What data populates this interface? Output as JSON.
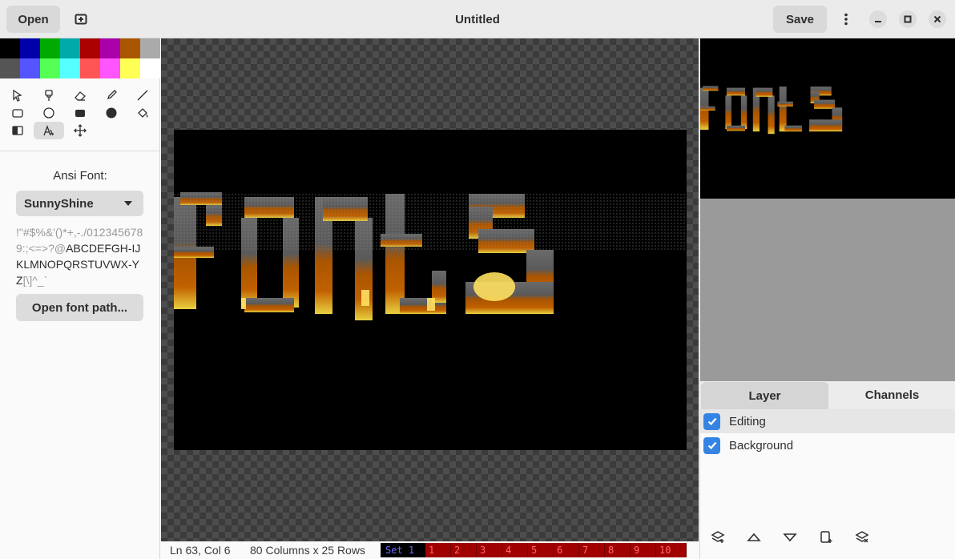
{
  "header": {
    "title": "Untitled",
    "open_label": "Open",
    "save_label": "Save",
    "icons": [
      "new-document-icon",
      "menu-icon",
      "minimize-icon",
      "maximize-icon",
      "close-icon"
    ]
  },
  "colors": {
    "foreground": "#aaaaaa",
    "background": "#000000",
    "palette_row1": [
      "#000000",
      "#0000aa",
      "#00aa00",
      "#00aaaa",
      "#aa0000",
      "#aa00aa",
      "#aa5500",
      "#aaaaaa"
    ],
    "palette_row2": [
      "#555555",
      "#5555ff",
      "#55ff55",
      "#55ffff",
      "#ff5555",
      "#ff55ff",
      "#ffff55",
      "#ffffff"
    ],
    "accent": "#3584e4"
  },
  "tools": [
    "select-tool",
    "brush-tool",
    "eraser-tool",
    "dropper-tool",
    "line-tool",
    "rectangle-outline-tool",
    "ellipse-outline-tool",
    "rectangle-filled-tool",
    "ellipse-filled-tool",
    "fill-tool",
    "shade-tool",
    "font-tool",
    "pan-tool"
  ],
  "font_panel": {
    "label": "Ansi Font:",
    "selected_font": "SunnyShine",
    "charset_dim1": "!\"#$%&'()*+,-./0123456789:;<=>?@",
    "charset_bright": "ABCDEFGH-IJKLMNOPQRSTUVWX-YZ",
    "charset_dim2": "[\\]^_`",
    "open_font_path_label": "Open font path..."
  },
  "canvas": {
    "text": "fonts"
  },
  "status": {
    "position": "Ln 63, Col 6",
    "size": "80 Columns x 25 Rows",
    "set_label": "Set  1",
    "fkeys": [
      "1",
      "2",
      "3",
      "4",
      "5",
      "6",
      "7",
      "8",
      "9",
      "10"
    ]
  },
  "layers_panel": {
    "tabs": [
      "Layer",
      "Channels"
    ],
    "active_tab": "Channels",
    "layers": [
      {
        "name": "Editing",
        "visible": true
      },
      {
        "name": "Background",
        "visible": true
      }
    ],
    "tool_icons": [
      "add-layer-icon",
      "move-layer-up-icon",
      "move-layer-down-icon",
      "duplicate-layer-icon",
      "delete-layer-icon"
    ]
  }
}
